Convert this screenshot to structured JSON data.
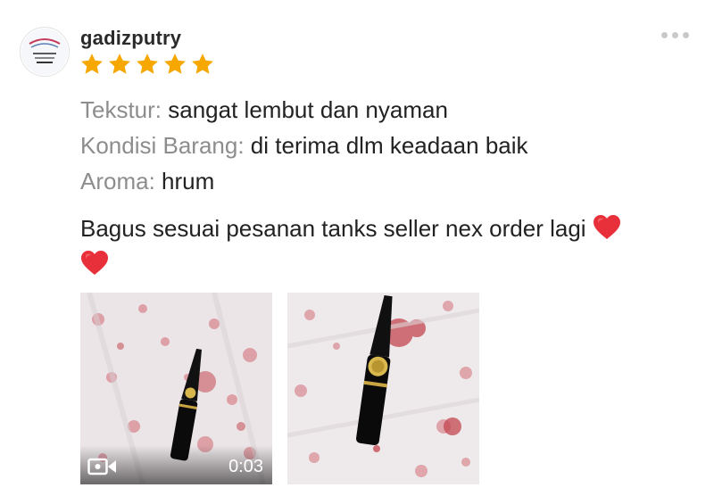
{
  "review": {
    "username": "gadizputry",
    "rating": 5,
    "attributes": [
      {
        "key": "Tekstur:",
        "value": "sangat lembut dan nyaman"
      },
      {
        "key": "Kondisi Barang:",
        "value": "di terima dlm keadaan baik"
      },
      {
        "key": "Aroma:",
        "value": "hrum"
      }
    ],
    "comment": "Bagus sesuai pesanan tanks seller nex order lagi",
    "media": [
      {
        "type": "video",
        "duration": "0:03"
      },
      {
        "type": "image"
      }
    ]
  },
  "icons": {
    "star": "star-icon",
    "heart": "heart-emoji",
    "more": "more-options-icon",
    "video": "video-camera-icon"
  },
  "colors": {
    "star": "#f6a700",
    "heart": "#e8303a",
    "label": "#8d8d8d",
    "text": "#222222"
  }
}
